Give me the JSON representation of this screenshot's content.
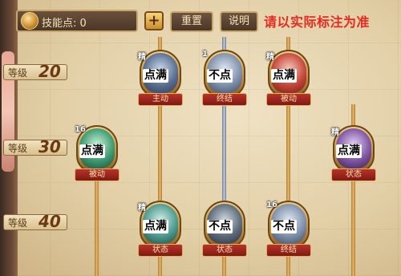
{
  "topbar": {
    "skill_points_label": "技能点: 0",
    "plus_label": "+",
    "reset_label": "重置",
    "help_label": "说明",
    "notice": "请以实际标注为准"
  },
  "levels": [
    {
      "label": "等级",
      "value": "20"
    },
    {
      "label": "等级",
      "value": "30"
    },
    {
      "label": "等级",
      "value": "40"
    }
  ],
  "nodes": [
    {
      "badge": "精",
      "tag": "点满",
      "type": "主动"
    },
    {
      "badge": "1",
      "tag": "不点",
      "type": "终结"
    },
    {
      "badge": "精",
      "tag": "点满",
      "type": "被动"
    },
    {
      "badge": "16",
      "tag": "点满",
      "type": "被动"
    },
    {
      "badge": "精",
      "tag": "点满",
      "type": "状态"
    },
    {
      "badge": "精",
      "tag": "点满",
      "type": "状态"
    },
    {
      "badge": "",
      "tag": "不点",
      "type": "状态"
    },
    {
      "badge": "16",
      "tag": "不点",
      "type": "终结"
    }
  ],
  "colors": {
    "notice": "#e62a1f",
    "path_gold": "#e8b964",
    "path_silver": "#c5cce0",
    "banner_red": "#b8322a"
  },
  "icons": [
    "coin-icon",
    "plus-icon"
  ]
}
